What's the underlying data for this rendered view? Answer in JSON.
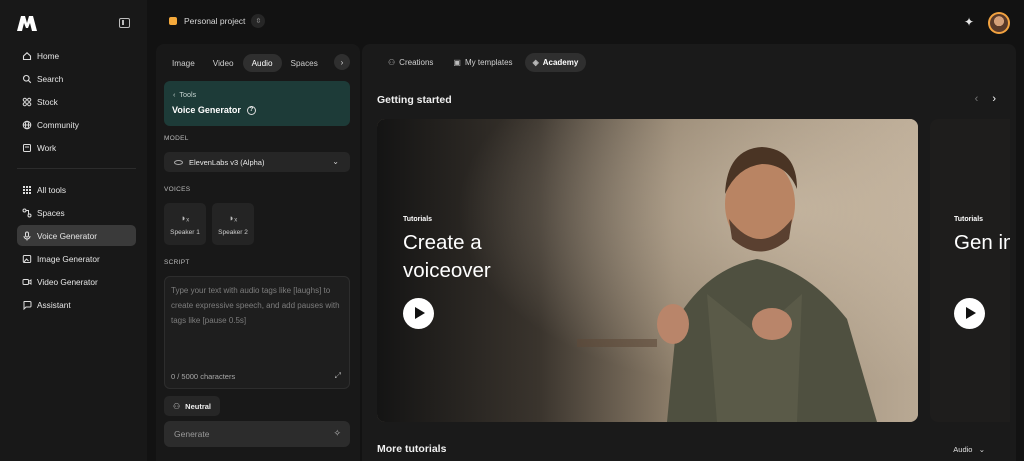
{
  "nav": {
    "items": [
      {
        "label": "Home",
        "icon": "home-icon"
      },
      {
        "label": "Search",
        "icon": "search-icon"
      },
      {
        "label": "Stock",
        "icon": "stock-icon"
      },
      {
        "label": "Community",
        "icon": "globe-icon"
      },
      {
        "label": "Work",
        "icon": "folder-icon"
      },
      {
        "label": "All tools",
        "icon": "grid-icon"
      },
      {
        "label": "Spaces",
        "icon": "spaces-icon"
      },
      {
        "label": "Voice Generator",
        "icon": "microphone-icon"
      },
      {
        "label": "Image Generator",
        "icon": "image-icon"
      },
      {
        "label": "Video Generator",
        "icon": "video-icon"
      },
      {
        "label": "Assistant",
        "icon": "assistant-icon"
      }
    ],
    "active": "Voice Generator"
  },
  "topbar": {
    "project_name": "Personal project"
  },
  "tool_panel": {
    "tabs": [
      "Image",
      "Video",
      "Audio",
      "Spaces"
    ],
    "active_tab": "Audio",
    "crumb": "Tools",
    "tool_name": "Voice Generator",
    "model_label": "MODEL",
    "model_value": "ElevenLabs v3 (Alpha)",
    "voices_label": "VOICES",
    "speakers": [
      "Speaker 1",
      "Speaker 2"
    ],
    "script_label": "SCRIPT",
    "script_placeholder": "Type your text with audio tags like [laughs] to create expressive speech, and add pauses with tags like [pause 0.5s]",
    "char_count": "0 / 5000 characters",
    "tone": "Neutral",
    "generate_label": "Generate"
  },
  "main": {
    "tabs": [
      {
        "label": "Creations",
        "icon": "creations-icon"
      },
      {
        "label": "My templates",
        "icon": "templates-icon"
      },
      {
        "label": "Academy",
        "icon": "academy-icon"
      }
    ],
    "active_tab": "Academy",
    "section_title": "Getting started",
    "cards": [
      {
        "kicker": "Tutorials",
        "title": "Create a voiceover"
      },
      {
        "kicker": "Tutorials",
        "title": "Gen imag"
      }
    ],
    "more_title": "More tutorials",
    "filter_label": "Audio"
  },
  "colors": {
    "accent_project": "#f5a93b",
    "tool_card": "#1d3b38",
    "active_nav": "#3a3a3a"
  }
}
